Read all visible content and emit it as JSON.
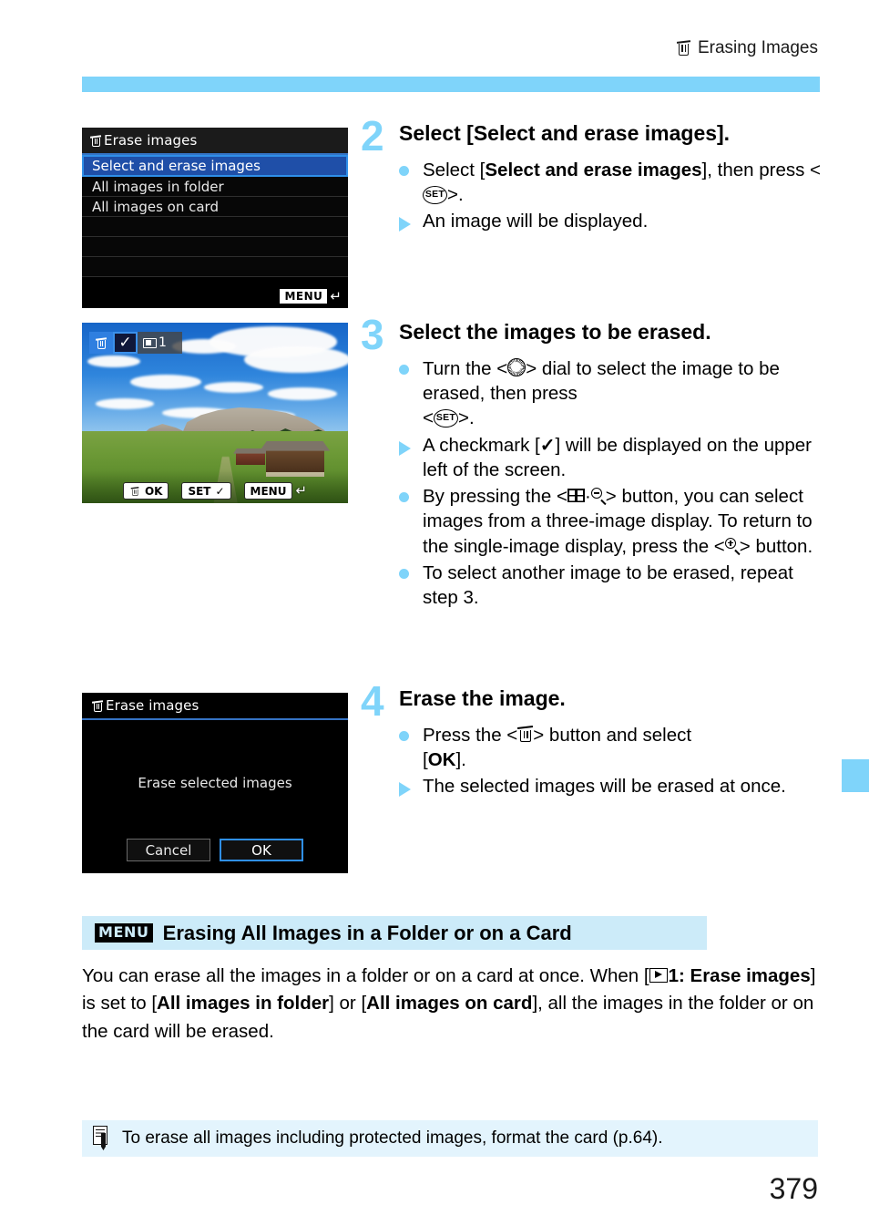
{
  "header": {
    "title": "Erasing Images",
    "icon": "trash-icon"
  },
  "shots": {
    "erase_menu": {
      "title": "Erase images",
      "title_icon": "trash-icon",
      "items": [
        "Select and erase images",
        "All images in folder",
        "All images on card"
      ],
      "selected_index": 0,
      "footer_badge": "MENU",
      "footer_arrow": "return-arrow"
    },
    "image_select": {
      "trash_icon": "trash-icon",
      "check_icon": "checkmark-icon",
      "count_icon": "folder-icon",
      "count_label": "1",
      "bottom_buttons": [
        {
          "icon": "trash-icon",
          "label": "OK"
        },
        {
          "icon": "",
          "label": "SET",
          "trail": "checkmark-icon"
        },
        {
          "icon": "",
          "label": "MENU",
          "trail": "return-arrow"
        }
      ]
    },
    "erase_confirm": {
      "title": "Erase images",
      "title_icon": "trash-icon",
      "message": "Erase selected images",
      "cancel_label": "Cancel",
      "ok_label": "OK",
      "focused_button": "OK"
    }
  },
  "steps": [
    {
      "number": "2",
      "title": "Select [Select and erase images].",
      "bullets": [
        {
          "marker": "dot",
          "segments": [
            {
              "t": "Select ["
            },
            {
              "t": "Select and erase images",
              "b": true
            },
            {
              "t": "], then press <"
            },
            {
              "sym": "set"
            },
            {
              "t": ">."
            }
          ]
        },
        {
          "marker": "triangle",
          "segments": [
            {
              "t": "An image will be displayed."
            }
          ]
        }
      ]
    },
    {
      "number": "3",
      "title": "Select the images to be erased.",
      "bullets": [
        {
          "marker": "dot",
          "segments": [
            {
              "t": "Turn the <"
            },
            {
              "sym": "dial"
            },
            {
              "t": "> dial to select the image to be erased, then press <"
            },
            {
              "sym": "set"
            },
            {
              "t": ">."
            }
          ]
        },
        {
          "marker": "triangle",
          "segments": [
            {
              "t": "A checkmark ["
            },
            {
              "sym": "check"
            },
            {
              "t": "] will be displayed on the upper left of the screen."
            }
          ]
        },
        {
          "marker": "dot",
          "segments": [
            {
              "t": "By pressing the <"
            },
            {
              "sym": "index"
            },
            {
              "t": "·"
            },
            {
              "sym": "magminus"
            },
            {
              "t": "> button, you can select images from a three-image display. To return to the single-image display, press the <"
            },
            {
              "sym": "magplus"
            },
            {
              "t": "> button."
            }
          ]
        },
        {
          "marker": "dot",
          "segments": [
            {
              "t": "To select another image to be erased, repeat step 3."
            }
          ]
        }
      ]
    },
    {
      "number": "4",
      "title": "Erase the image.",
      "bullets": [
        {
          "marker": "dot",
          "segments": [
            {
              "t": "Press the <"
            },
            {
              "sym": "trash"
            },
            {
              "t": "> button and select ["
            },
            {
              "t": "OK",
              "b": true
            },
            {
              "t": "]."
            }
          ]
        },
        {
          "marker": "triangle",
          "segments": [
            {
              "t": "The selected images will be erased at once."
            }
          ]
        }
      ]
    }
  ],
  "section": {
    "icon_label": "MENU",
    "title": "Erasing All Images in a Folder or on a Card",
    "body_segments": [
      {
        "t": "You can erase all the images in a folder or on a card at once. When ["
      },
      {
        "sym": "play"
      },
      {
        "t": "1: Erase images",
        "b": true
      },
      {
        "t": "] is set to ["
      },
      {
        "t": "All images in folder",
        "b": true
      },
      {
        "t": "] or ["
      },
      {
        "t": "All images on card",
        "b": true
      },
      {
        "t": "], all the images in the folder or on the card will be erased."
      }
    ]
  },
  "note": {
    "icon": "note-pencil-icon",
    "text": "To erase all images including protected images, format the card (p.64)."
  },
  "page_number": "379",
  "colors": {
    "accent_blue": "#7fd4fa",
    "section_bg": "#ccebf9",
    "note_bg": "#e3f4fd",
    "menu_select_blue": "#1f4fa8"
  }
}
